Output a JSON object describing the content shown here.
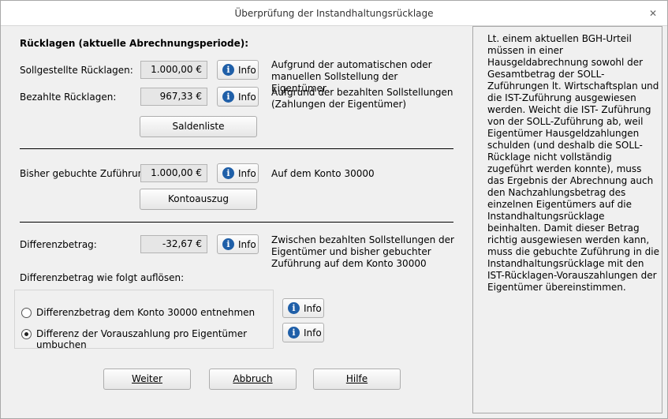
{
  "window": {
    "title": "Überprüfung der Instandhaltungsrücklage",
    "close_icon": "close-icon"
  },
  "section1": {
    "heading": "Rücklagen (aktuelle Abrechnungsperiode):",
    "soll_label": "Sollgestellte Rücklagen:",
    "soll_value": "1.000,00 €",
    "soll_desc": "Aufgrund der automatischen oder manuellen Sollstellung der Eigentümer",
    "bezahlt_label": "Bezahlte Rücklagen:",
    "bezahlt_value": "967,33 €",
    "bezahlt_desc": "Aufgrund der bezahlten Sollstellungen (Zahlungen der Eigentümer)",
    "saldenliste_label": "Saldenliste"
  },
  "section2": {
    "label": "Bisher gebuchte Zuführung:",
    "value": "1.000,00 €",
    "desc": "Auf dem Konto 30000",
    "kontoauszug_label": "Kontoauszug"
  },
  "section3": {
    "label": "Differenzbetrag:",
    "value": "-32,67 €",
    "desc": "Zwischen bezahlten Sollstellungen der Eigentümer und bisher gebuchter Zuführung auf dem Konto 30000",
    "resolve_label": "Differenzbetrag wie folgt auflösen:",
    "option1": "Differenzbetrag dem Konto 30000 entnehmen",
    "option2": "Differenz der Vorauszahlung pro Eigentümer umbuchen",
    "selected_option": 2
  },
  "info_label": "Info",
  "buttons": {
    "weiter": "Weiter",
    "abbruch": "Abbruch",
    "hilfe": "Hilfe"
  },
  "side_panel": {
    "text": "Lt. einem aktuellen BGH-Urteil müssen in einer Hausgeldabrechnung sowohl der Gesamtbetrag der SOLL-Zuführungen lt. Wirtschaftsplan und die IST-Zuführung ausgewiesen werden. Weicht die IST- Zuführung von der SOLL-Zuführung ab, weil Eigentümer Hausgeldzahlungen schulden (und deshalb die SOLL-Rücklage nicht vollständig zugeführt werden konnte), muss das Ergebnis der Abrechnung auch den Nachzahlungsbetrag des einzelnen Eigentümers auf die Instandhaltungsrücklage beinhalten. Damit dieser Betrag richtig ausgewiesen werden kann, muss die gebuchte Zuführung in die Instandhaltungsrücklage mit den IST-Rücklagen-Vorauszahlungen der Eigentümer übereinstimmen."
  },
  "colors": {
    "info_icon": "#1f5fa8",
    "background": "#f0f0f0"
  }
}
